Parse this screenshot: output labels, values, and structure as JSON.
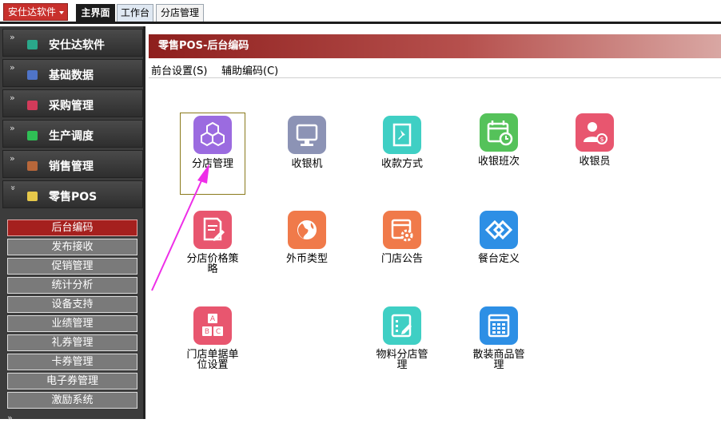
{
  "topbar": {
    "app_button": "安仕达软件",
    "tabs": [
      {
        "label": "主界面"
      },
      {
        "label": "工作台"
      },
      {
        "label": "分店管理"
      }
    ]
  },
  "sidebar": {
    "groups": [
      {
        "label": "安仕达软件",
        "icon": "teal-cube-icon",
        "color": "#2aa88a",
        "chevron": "»"
      },
      {
        "label": "基础数据",
        "icon": "blue-cube-icon",
        "color": "#4f74c8",
        "chevron": "»"
      },
      {
        "label": "采购管理",
        "icon": "red-cube-icon",
        "color": "#d23b5a",
        "chevron": "»"
      },
      {
        "label": "生产调度",
        "icon": "green-cube-icon",
        "color": "#2fbf55",
        "chevron": "»"
      },
      {
        "label": "销售管理",
        "icon": "brown-cube-icon",
        "color": "#b8673a",
        "chevron": "»"
      },
      {
        "label": "零售POS",
        "icon": "yellow-cube-icon",
        "color": "#e6c84a",
        "chevron": "»"
      }
    ],
    "subitems": [
      {
        "label": "后台编码",
        "active": true
      },
      {
        "label": "发布接收"
      },
      {
        "label": "促销管理"
      },
      {
        "label": "统计分析"
      },
      {
        "label": "设备支持"
      },
      {
        "label": "业绩管理"
      },
      {
        "label": "礼券管理"
      },
      {
        "label": "卡券管理"
      },
      {
        "label": "电子券管理"
      },
      {
        "label": "激励系统"
      }
    ],
    "tail_chevron": "»"
  },
  "panel": {
    "title": "零售POS-后台编码",
    "menubar": [
      {
        "label": "前台设置(S)"
      },
      {
        "label": "辅助编码(C)"
      }
    ],
    "tiles": [
      {
        "label": "分店管理",
        "icon": "cubes-icon",
        "color": "#9b6be0"
      },
      {
        "label": "收银机",
        "icon": "monitor-icon",
        "color": "#8c93b5"
      },
      {
        "label": "收款方式",
        "icon": "pin-note-icon",
        "color": "#3fcfc4"
      },
      {
        "label": "收银班次",
        "icon": "calendar-clock-icon",
        "color": "#55c25a"
      },
      {
        "label": "收银员",
        "icon": "cashier-person-icon",
        "color": "#e8566f"
      },
      {
        "label": "分店价格策略",
        "icon": "document-edit-icon",
        "color": "#e8566f"
      },
      {
        "label": "外币类型",
        "icon": "globe-icon",
        "color": "#f07a4a"
      },
      {
        "label": "门店公告",
        "icon": "gear-window-icon",
        "color": "#f07a4a"
      },
      {
        "label": "餐台定义",
        "icon": "diamond-link-icon",
        "color": "#2d8fe5"
      },
      {
        "label": "门店单据单位设置",
        "icon": "abc-blocks-icon",
        "color": "#e8566f"
      },
      {
        "label": "物料分店管理",
        "icon": "checklist-edit-icon",
        "color": "#3fcfc4"
      },
      {
        "label": "散装商品管理",
        "icon": "grid-table-icon",
        "color": "#2d8fe5"
      }
    ]
  },
  "annotation": {
    "arrow_color": "#ee2ee8"
  }
}
